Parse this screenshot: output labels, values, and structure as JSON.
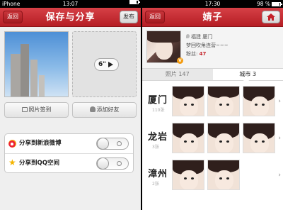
{
  "left": {
    "status": {
      "carrier": "iPhone",
      "time": "13:07",
      "battery": ""
    },
    "title": "保存与分享",
    "back_label": "返回",
    "publish_label": "发布",
    "video_duration": "6\"",
    "checkin_label": "照片签到",
    "add_friend_label": "添加好友",
    "share": [
      {
        "label": "分享到新浪微博",
        "icon": "weibo-icon",
        "enabled": false
      },
      {
        "label": "分享到QQ空间",
        "icon": "qzone-star-icon",
        "enabled": false
      }
    ]
  },
  "right": {
    "status": {
      "carrier": "",
      "time": "17:30",
      "battery": "98 %"
    },
    "title": "婧子",
    "back_label": "返回",
    "profile": {
      "location": "福建  厦门",
      "bio": "梦回吹角连营~~~",
      "fans_label": "粉丝:",
      "fans_count": "47",
      "verified_mark": "V"
    },
    "tabs": [
      {
        "label": "照片 147",
        "active": false
      },
      {
        "label": "城市 3",
        "active": true
      }
    ],
    "cities": [
      {
        "name": "厦门",
        "count": "110张"
      },
      {
        "name": "龙岩",
        "count": "3张"
      },
      {
        "name": "漳州",
        "count": "2张"
      }
    ]
  },
  "colors": {
    "nav_red": "#c4232a",
    "accent_orange": "#f39c12"
  }
}
